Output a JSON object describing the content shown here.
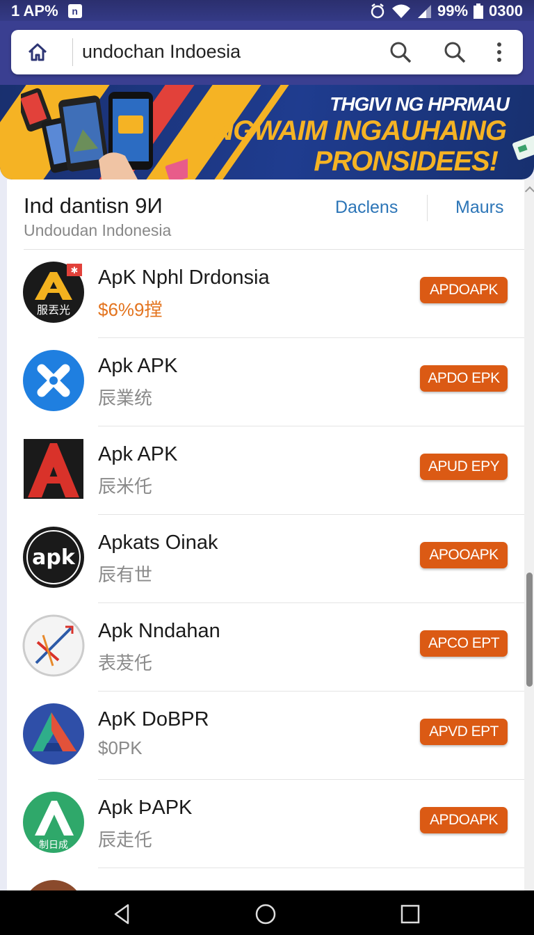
{
  "status_bar": {
    "left_text": "1 AP%",
    "notification_icon": "n",
    "battery": "99%",
    "time": "0300",
    "icons": [
      "alarm-icon",
      "wifi-icon",
      "signal-icon",
      "battery-icon"
    ]
  },
  "url_bar": {
    "text": "undochan Indoesia",
    "icons": [
      "home-icon",
      "search-icon",
      "search-icon",
      "more-vert-icon"
    ]
  },
  "banner": {
    "line1": "THGIVI NG HPRMAU",
    "line2": "NGWAIM INGAUHAING",
    "line3": "PRONSIDEES!"
  },
  "header": {
    "title": "Ind dantisn 9И",
    "subtitle": "Undoudan Indonesia",
    "link1": "Daclens",
    "link2": "Maurs"
  },
  "apps": [
    {
      "name": "ApK Nphl Drdonsia",
      "subtitle": "$6%9摚",
      "button": "APDOAPK",
      "subtitle_is_price": true,
      "icon": "apk-a-black-icon",
      "icon_caption": "服丟光"
    },
    {
      "name": "Apk APK",
      "subtitle": "辰業统",
      "button": "APDO EPK",
      "icon": "blue-bluetooth-icon"
    },
    {
      "name": "Apk APK",
      "subtitle": "辰米仛",
      "button": "APUD EPY",
      "icon": "red-a-icon"
    },
    {
      "name": "Apkats Oinak",
      "subtitle": "辰有世",
      "button": "APOOAPK",
      "icon": "apk-logo-icon",
      "icon_caption": "apk"
    },
    {
      "name": "Apk Nndahan",
      "subtitle": "表茇仛",
      "button": "APCO EPT",
      "icon": "sketch-arrow-icon"
    },
    {
      "name": "ApK DoBPR",
      "subtitle": "$0PK",
      "button": "APVD EPT",
      "icon": "gradient-a-icon"
    },
    {
      "name": "Apk ÞAPK",
      "subtitle": "辰走仛",
      "button": "APDOAPK",
      "icon": "green-a-icon",
      "icon_caption": "制日成"
    }
  ],
  "nav_bar": {
    "icons": [
      "back-icon",
      "home-circle-icon",
      "recents-icon"
    ]
  },
  "colors": {
    "accent": "#db5a14",
    "link": "#2c75b7",
    "topbar": "#343a86",
    "banner_yellow": "#f5b324"
  }
}
